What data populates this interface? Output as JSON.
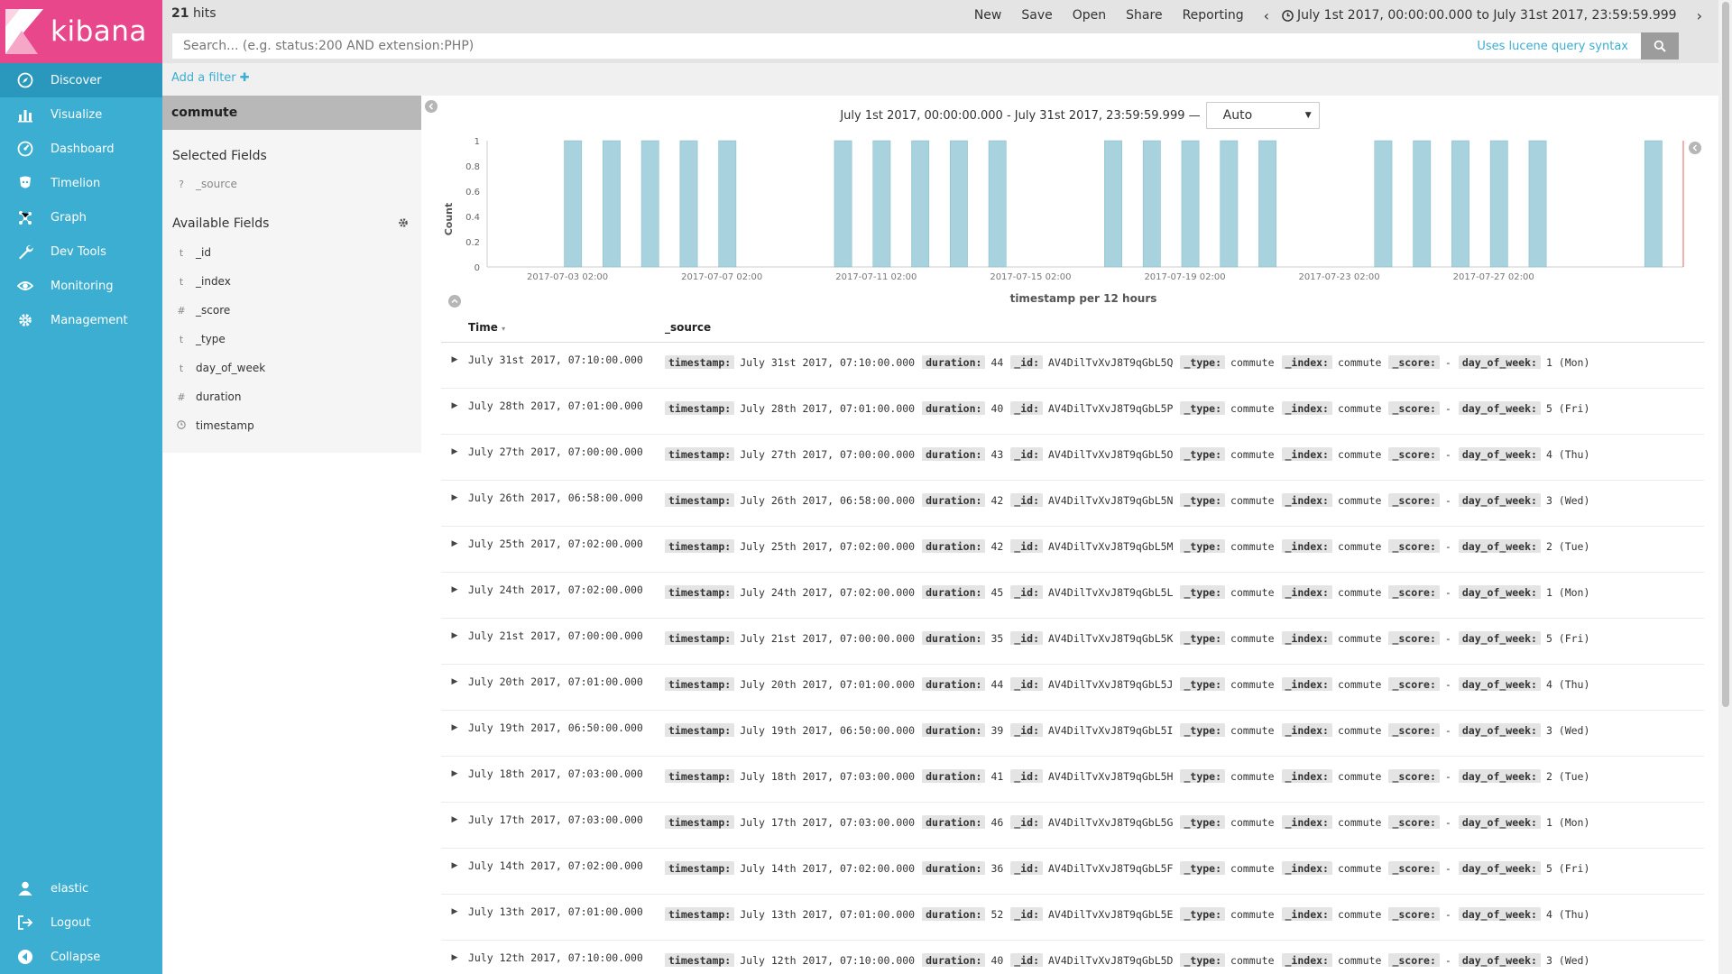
{
  "app": {
    "name": "kibana"
  },
  "colors": {
    "sidebar": "#3caed2",
    "logo": "#e8488b",
    "bar": "#a8d2dd",
    "accent": "#3caed2"
  },
  "nav": {
    "items": [
      {
        "label": "Discover",
        "icon": "compass-icon"
      },
      {
        "label": "Visualize",
        "icon": "bar-chart-icon"
      },
      {
        "label": "Dashboard",
        "icon": "dashboard-icon"
      },
      {
        "label": "Timelion",
        "icon": "timelion-icon"
      },
      {
        "label": "Graph",
        "icon": "graph-icon"
      },
      {
        "label": "Dev Tools",
        "icon": "wrench-icon"
      },
      {
        "label": "Monitoring",
        "icon": "eye-icon"
      },
      {
        "label": "Management",
        "icon": "gear-icon"
      }
    ],
    "bottom": [
      {
        "label": "elastic",
        "icon": "user-icon"
      },
      {
        "label": "Logout",
        "icon": "logout-icon"
      },
      {
        "label": "Collapse",
        "icon": "collapse-icon"
      }
    ]
  },
  "topbar": {
    "hits_count": "21",
    "hits_label": "hits",
    "menu": [
      "New",
      "Save",
      "Open",
      "Share",
      "Reporting"
    ],
    "time_range": "July 1st 2017, 00:00:00.000 to July 31st 2017, 23:59:59.999"
  },
  "search": {
    "placeholder": "Search... (e.g. status:200 AND extension:PHP)",
    "value": "",
    "lucene_link": "Uses lucene query syntax"
  },
  "filter": {
    "add_label": "Add a filter"
  },
  "fields": {
    "index_pattern": "commute",
    "selected_title": "Selected Fields",
    "selected": [
      {
        "type": "?",
        "name": "_source"
      }
    ],
    "available_title": "Available Fields",
    "available": [
      {
        "type": "t",
        "name": "_id"
      },
      {
        "type": "t",
        "name": "_index"
      },
      {
        "type": "#",
        "name": "_score"
      },
      {
        "type": "t",
        "name": "_type"
      },
      {
        "type": "t",
        "name": "day_of_week"
      },
      {
        "type": "#",
        "name": "duration"
      },
      {
        "type": "clock",
        "name": "timestamp"
      }
    ]
  },
  "chart_header": {
    "range": "July 1st 2017, 00:00:00.000 - July 31st 2017, 23:59:59.999 —",
    "interval": "Auto"
  },
  "chart_data": {
    "type": "bar",
    "xlabel": "timestamp per 12 hours",
    "ylabel": "Count",
    "ylim": [
      0,
      1
    ],
    "yticks": [
      0,
      0.2,
      0.4,
      0.6,
      0.8,
      1
    ],
    "xlim": [
      "2017-07-01 00:00",
      "2017-08-01 00:00"
    ],
    "xticks": [
      "2017-07-03 02:00",
      "2017-07-07 02:00",
      "2017-07-11 02:00",
      "2017-07-15 02:00",
      "2017-07-19 02:00",
      "2017-07-23 02:00",
      "2017-07-27 02:00"
    ],
    "x": [
      "2017-07-03 00:00",
      "2017-07-04 00:00",
      "2017-07-05 00:00",
      "2017-07-06 00:00",
      "2017-07-07 00:00",
      "2017-07-10 00:00",
      "2017-07-11 00:00",
      "2017-07-12 00:00",
      "2017-07-13 00:00",
      "2017-07-14 00:00",
      "2017-07-17 00:00",
      "2017-07-18 00:00",
      "2017-07-19 00:00",
      "2017-07-20 00:00",
      "2017-07-21 00:00",
      "2017-07-24 00:00",
      "2017-07-25 00:00",
      "2017-07-26 00:00",
      "2017-07-27 00:00",
      "2017-07-28 00:00",
      "2017-07-31 00:00"
    ],
    "values": [
      1,
      1,
      1,
      1,
      1,
      1,
      1,
      1,
      1,
      1,
      1,
      1,
      1,
      1,
      1,
      1,
      1,
      1,
      1,
      1,
      1
    ],
    "grid": false
  },
  "table": {
    "time_header": "Time",
    "source_header": "_source",
    "rows": [
      {
        "time": "July 31st 2017, 07:10:00.000",
        "duration": "44",
        "id": "AV4DilTvXvJ8T9qGbL5Q",
        "dow": "1 (Mon)"
      },
      {
        "time": "July 28th 2017, 07:01:00.000",
        "duration": "40",
        "id": "AV4DilTvXvJ8T9qGbL5P",
        "dow": "5 (Fri)"
      },
      {
        "time": "July 27th 2017, 07:00:00.000",
        "duration": "43",
        "id": "AV4DilTvXvJ8T9qGbL5O",
        "dow": "4 (Thu)"
      },
      {
        "time": "July 26th 2017, 06:58:00.000",
        "duration": "42",
        "id": "AV4DilTvXvJ8T9qGbL5N",
        "dow": "3 (Wed)"
      },
      {
        "time": "July 25th 2017, 07:02:00.000",
        "duration": "42",
        "id": "AV4DilTvXvJ8T9qGbL5M",
        "dow": "2 (Tue)"
      },
      {
        "time": "July 24th 2017, 07:02:00.000",
        "duration": "45",
        "id": "AV4DilTvXvJ8T9qGbL5L",
        "dow": "1 (Mon)"
      },
      {
        "time": "July 21st 2017, 07:00:00.000",
        "duration": "35",
        "id": "AV4DilTvXvJ8T9qGbL5K",
        "dow": "5 (Fri)"
      },
      {
        "time": "July 20th 2017, 07:01:00.000",
        "duration": "44",
        "id": "AV4DilTvXvJ8T9qGbL5J",
        "dow": "4 (Thu)"
      },
      {
        "time": "July 19th 2017, 06:50:00.000",
        "duration": "39",
        "id": "AV4DilTvXvJ8T9qGbL5I",
        "dow": "3 (Wed)"
      },
      {
        "time": "July 18th 2017, 07:03:00.000",
        "duration": "41",
        "id": "AV4DilTvXvJ8T9qGbL5H",
        "dow": "2 (Tue)"
      },
      {
        "time": "July 17th 2017, 07:03:00.000",
        "duration": "46",
        "id": "AV4DilTvXvJ8T9qGbL5G",
        "dow": "1 (Mon)"
      },
      {
        "time": "July 14th 2017, 07:02:00.000",
        "duration": "36",
        "id": "AV4DilTvXvJ8T9qGbL5F",
        "dow": "5 (Fri)"
      },
      {
        "time": "July 13th 2017, 07:01:00.000",
        "duration": "52",
        "id": "AV4DilTvXvJ8T9qGbL5E",
        "dow": "4 (Thu)"
      },
      {
        "time": "July 12th 2017, 07:10:00.000",
        "duration": "40",
        "id": "AV4DilTvXvJ8T9qGbL5D",
        "dow": "3 (Wed)"
      }
    ],
    "source_labels": {
      "timestamp": "timestamp:",
      "duration": "duration:",
      "id": "_id:",
      "type": "_type:",
      "type_value": "commute",
      "index": "_index:",
      "index_value": "commute",
      "score": "_score:",
      "score_value": "-",
      "dow": "day_of_week:"
    }
  }
}
